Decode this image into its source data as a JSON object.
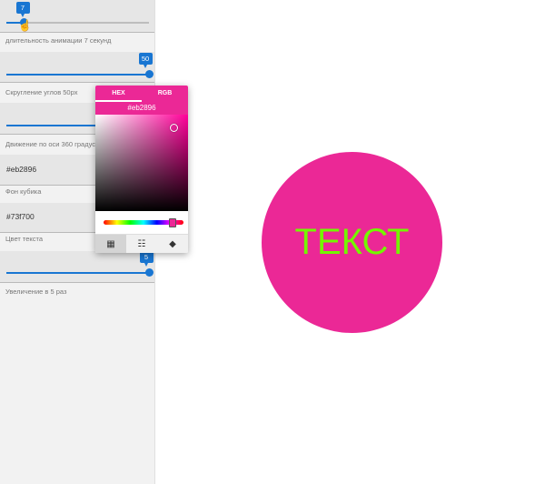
{
  "controls": {
    "duration": {
      "value": "7",
      "fraction": 0.12,
      "helper": "длительность анимации 7 секунд"
    },
    "radius": {
      "value": "50",
      "fraction": 1.0,
      "helper": "Скругление углов 50px"
    },
    "rotation": {
      "fraction": 0.85,
      "helper": "Движение по оси 360 градусов"
    },
    "bg_color": {
      "value": "#eb2896",
      "helper": "Фон кубика"
    },
    "text_color": {
      "value": "#73f700",
      "helper": "Цвет текста"
    },
    "scale": {
      "value": "5",
      "fraction": 1.0,
      "helper": "Увеличение в 5 раз"
    }
  },
  "picker": {
    "tab_hex": "HEX",
    "tab_rgb": "RGB",
    "hex": "#eb2896",
    "footer_icons": [
      "palette-icon",
      "sliders-icon",
      "swatch-icon"
    ]
  },
  "preview": {
    "text": "ТЕКСТ",
    "bg": "#eb2896",
    "color": "#73f700"
  },
  "colors": {
    "accent": "#1976d2",
    "picker": "#eb2896"
  }
}
